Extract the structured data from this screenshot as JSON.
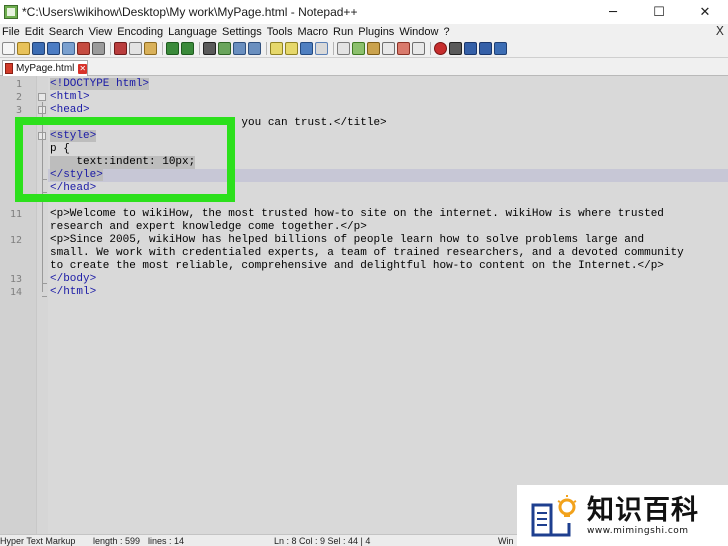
{
  "window": {
    "title": "*C:\\Users\\wikihow\\Desktop\\My work\\MyPage.html - Notepad++",
    "minimize": "─",
    "maximize": "☐",
    "close": "✕"
  },
  "menu": {
    "items": [
      "File",
      "Edit",
      "Search",
      "View",
      "Encoding",
      "Language",
      "Settings",
      "Tools",
      "Macro",
      "Run",
      "Plugins",
      "Window",
      "?"
    ],
    "close": "X"
  },
  "toolbar": {
    "buttons": [
      "new-file",
      "open-file",
      "save",
      "save-all",
      "close",
      "close-all",
      "print",
      "cut",
      "copy",
      "paste",
      "undo",
      "redo",
      "find",
      "replace",
      "zoom-in",
      "zoom-out",
      "sync-vertical",
      "sync-horizontal",
      "word-wrap",
      "show-all-chars",
      "indent-guide",
      "user-defined-language",
      "doc-map",
      "function-list",
      "folder-as-workspace",
      "monitoring",
      "record-macro",
      "stop-recording",
      "play-macro",
      "run-macro-multiple",
      "save-macro"
    ]
  },
  "tab": {
    "label": "MyPage.html"
  },
  "editor": {
    "line_numbers": [
      "1",
      "2",
      "3",
      "",
      "",
      "",
      "",
      "",
      "",
      "11",
      "",
      "12",
      "",
      "",
      "13",
      "14"
    ],
    "lines": {
      "l1": "<!DOCTYPE html>",
      "l2": "<html>",
      "l3": "<head>",
      "l4": "  <title>How-to instructions you can trust.</title>",
      "l5": "<style>",
      "l6": "p {",
      "l7": "    text:indent: 10px;",
      "l8": "</style>",
      "l9": "</head>",
      "l11a": "<p>Welcome to wikiHow, the most trusted how-to site on the internet. wikiHow is where trusted",
      "l11b": "research and expert knowledge come together.</p>",
      "l12a": "<p>Since 2005, wikiHow has helped billions of people learn how to solve problems large and",
      "l12b": "small. We work with credentialed experts, a team of trained researchers, and a devoted community",
      "l12c": "to create the most reliable, comprehensive and delightful how-to content on the Internet.</p>",
      "l13": "</body>",
      "l14": "</html>"
    }
  },
  "statusbar": {
    "type": "Hyper Text Markup",
    "length": "length : 599",
    "lines": "lines : 14",
    "position": "Ln : 8    Col : 9    Sel : 44 | 4",
    "eol": "Win"
  },
  "watermark": {
    "brand_cn": "知识百科",
    "url": "www.mimingshi.com"
  },
  "colors": {
    "highlight_box": "#2ce01c",
    "tag_color": "#1a1aa6",
    "current_line": "#c7c7d6"
  }
}
